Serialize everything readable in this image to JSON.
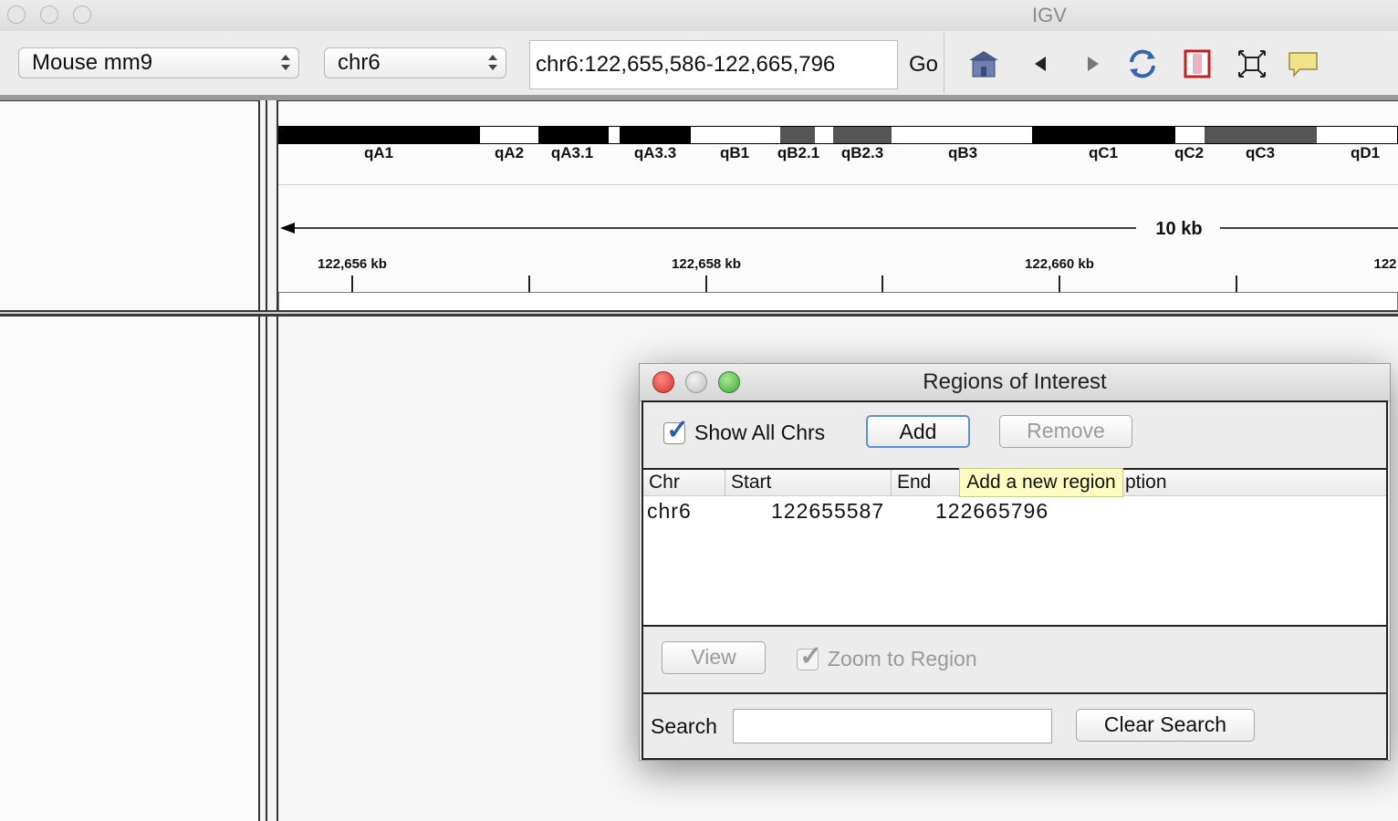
{
  "window": {
    "title": "IGV"
  },
  "toolbar": {
    "genome": "Mouse mm9",
    "chromosome": "chr6",
    "locus": "chr6:122,655,586-122,665,796",
    "go_label": "Go",
    "icons": [
      "home-icon",
      "back-icon",
      "forward-icon",
      "refresh-icon",
      "roi-icon",
      "resize-icon",
      "popup-text-icon"
    ]
  },
  "ideogram": {
    "bands": [
      "qA1",
      "qA2",
      "qA3.1",
      "qA3.3",
      "qB1",
      "qB2.1",
      "qB2.3",
      "qB3",
      "qC1",
      "qC2",
      "qC3",
      "qD1"
    ]
  },
  "ruler": {
    "span_label": "10 kb",
    "ticks": [
      "122,656 kb",
      "122,658 kb",
      "122,660 kb",
      "122"
    ]
  },
  "roi_dialog": {
    "title": "Regions of Interest",
    "show_all_chrs_label": "Show All Chrs",
    "show_all_chrs_checked": true,
    "add_label": "Add",
    "remove_label": "Remove",
    "tooltip": "Add a new region",
    "columns": [
      "Chr",
      "Start",
      "End",
      "Description"
    ],
    "header_visible": {
      "description_tail": "ption"
    },
    "rows": [
      {
        "chr": "chr6",
        "start": "122655587",
        "end": "122665796",
        "description": ""
      }
    ],
    "view_label": "View",
    "zoom_to_region_label": "Zoom to Region",
    "zoom_to_region_checked": true,
    "search_label": "Search",
    "search_value": "",
    "clear_search_label": "Clear Search"
  }
}
